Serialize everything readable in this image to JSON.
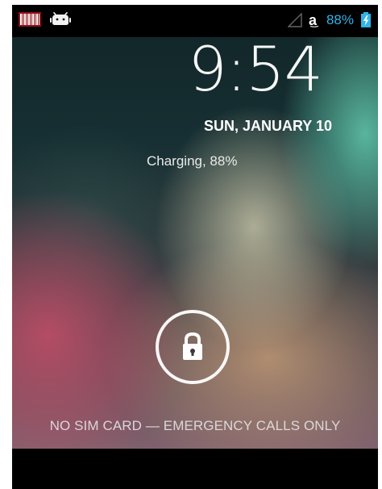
{
  "status_bar": {
    "battery_percent": "88%",
    "icons": {
      "left": [
        "barcode-icon",
        "android-icon"
      ],
      "right": [
        "signal-icon",
        "amazon-icon",
        "battery-icon"
      ]
    },
    "colors": {
      "battery_text": "#2fb5e8",
      "background": "#000000",
      "foreground": "#ffffff"
    }
  },
  "lock_screen": {
    "time": "9:54",
    "date": "SUN, JANUARY 10",
    "charging": "Charging, 88%",
    "emergency": "NO SIM CARD — EMERGENCY CALLS ONLY",
    "unlock_icon": "lock-icon"
  }
}
